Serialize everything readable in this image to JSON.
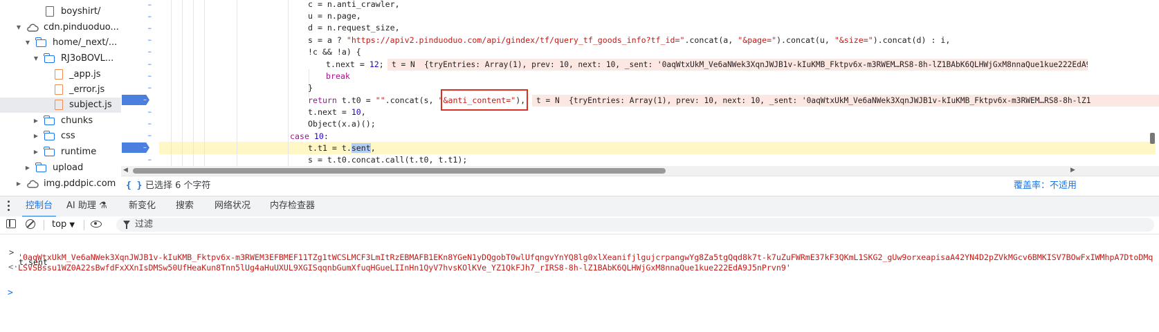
{
  "tree": {
    "items": [
      {
        "label": "boyshirt/",
        "kind": "file"
      },
      {
        "label": "cdn.pinduoduo...",
        "kind": "cloud"
      },
      {
        "label": "home/_next/...",
        "kind": "folder"
      },
      {
        "label": "RJ3oBOVL...",
        "kind": "folder"
      },
      {
        "label": "_app.js",
        "kind": "js"
      },
      {
        "label": "_error.js",
        "kind": "js"
      },
      {
        "label": "subject.js",
        "kind": "js"
      },
      {
        "label": "chunks",
        "kind": "folder"
      },
      {
        "label": "css",
        "kind": "folder"
      },
      {
        "label": "runtime",
        "kind": "folder"
      },
      {
        "label": "upload",
        "kind": "folder"
      },
      {
        "label": "img.pddpic.com",
        "kind": "cloud"
      }
    ]
  },
  "code": {
    "gutter_mark": "–",
    "l1": "c = n.anti_crawler,",
    "l2": "u = n.page,",
    "l3": "d = n.request_size,",
    "l4_a": "s = a ? ",
    "l4_s1": "\"https://apiv2.pinduoduo.com/api/gindex/tf/query_tf_goods_info?tf_id=\"",
    "l4_b": ".concat(a, ",
    "l4_s2": "\"&page=\"",
    "l4_c": ").concat(u, ",
    "l4_s3": "\"&size=\"",
    "l4_d": ").concat(d) : i,",
    "l5": "!c && !a) {",
    "l6_a": "t.next = ",
    "l6_num": "12",
    "l6_b": ";",
    "inline1": "t = N  {tryEntries: Array(1), prev: 10, next: 10, _sent: '0aqWtxUkM_Ve6aNWek3XqnJWJB1v-kIuKMB_Fktpv6x-m3RWEM…RS8-8h-lZ1BAbK6QLHWjGxM8nnaQue1kue222EdA9J",
    "l7": "break",
    "l8": "}",
    "l9_kw": "return",
    "l9_a": " t.t0 = ",
    "l9_s1": "\"\"",
    "l9_b": ".",
    "l9_c": "concat(s, ",
    "l9_s2": "\"&anti_content=\"",
    "l9_d": "),",
    "inline2": "t = N  {tryEntries: Array(1), prev: 10, next: 10, _sent: '0aqWtxUkM_Ve6aNWek3XqnJWJB1v-kIuKMB_Fktpv6x-m3RWEM…RS8-8h-lZ1",
    "l10_a": "t.next = ",
    "l10_num": "10",
    "l10_b": ",",
    "l11": "Object(x.a)();",
    "l12_kw": "case",
    "l12_num": " 10",
    "l12_b": ":",
    "l13_a": "t.t1 = t.",
    "l13_sel": "sent",
    "l13_b": ",",
    "l14": "s = t.t0.concat.call(t.t0, t.t1);"
  },
  "status": {
    "curly": "{ }",
    "selected": "已选择 6 个字符",
    "coverage": "覆盖率：不适用"
  },
  "drawer": {
    "tabs": [
      {
        "label": "控制台",
        "active": true
      },
      {
        "label": "AI 助理 ⚗",
        "active": false
      },
      {
        "label": "新变化",
        "active": false
      },
      {
        "label": "搜索",
        "active": false
      },
      {
        "label": "网络状况",
        "active": false
      },
      {
        "label": "内存检查器",
        "active": false
      }
    ]
  },
  "console_toolbar": {
    "context": "top",
    "filter_placeholder": "过滤"
  },
  "console": {
    "input_prompt": ">",
    "input": "t.sent",
    "output_arrow": "<·",
    "output_line1": "'0aqWtxUkM_Ve6aNWek3XqnJWJB1v-kIuKMB_Fktpv6x-m3RWEM3EFBMEF11TZg1tWCSLMCF3LmItRzEBMAFB1EKn8YGeN1yDQgobT0wlUfqngvYnYQ8lg0xlXeanifjlgujcrpangwYg8Za5tgQqd8k7t-k7uZuFWRmE37kF3QKmL1SKG2_gUw9orxeapisaA42YN4D2pZVkMGcv6BMKISV7BOwFxIWMhpA7DtoDMq",
    "output_line2": "LSVSBssu1WZ0A22sBwfdFxXXnIsDMSw50UfHeaKun8Tnn5lUg4aHuUXUL9XGISqqnbGumXfuqHGueLIInHn1QyV7hvsKOlKVe_YZ1QkFJh7_rIRS8-8h-lZ1BAbK6QLHWjGxM8nnaQue1kue222EdA9J5nPrvn9'",
    "caret": ">"
  }
}
